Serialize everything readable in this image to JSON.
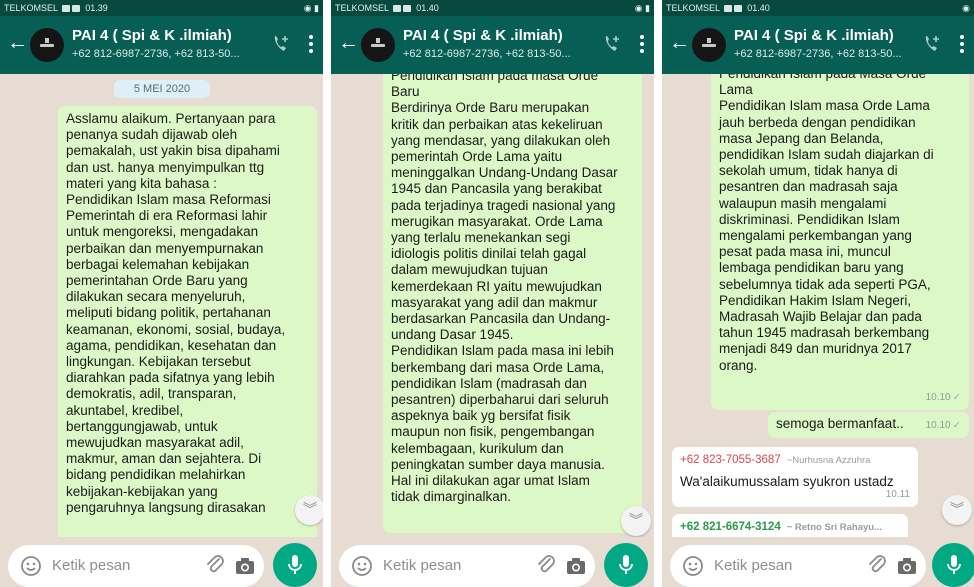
{
  "status": {
    "carrier": "TELKOMSEL",
    "times": [
      "01.39",
      "01.40",
      "01.40"
    ]
  },
  "chat": {
    "title": "PAI 4 ( Spi & K .ilmiah)",
    "members_preview": "+62 812-6987-2736, +62 813-50..."
  },
  "input": {
    "placeholder": "Ketik pesan"
  },
  "icons": {
    "back": "arrow-left-icon",
    "call": "add-call-icon",
    "menu": "more-vert-icon",
    "emoji": "emoji-icon",
    "attach": "paperclip-icon",
    "camera": "camera-icon",
    "mic": "mic-icon",
    "scroll": "chevron-double-down-icon"
  },
  "colors": {
    "header": "#075e54",
    "bubble_out": "#dcf8c6",
    "accent": "#00a884"
  },
  "panel1": {
    "date_chip": "5 MEI 2020",
    "message": "Asslamu alaikum. Pertanyaan para\npenanya  sudah dijawab oleh\npemakalah, ust yakin bisa dipahami\ndan ust. hanya menyimpulkan ttg\nmateri yang kita bahasa :\n Pendidikan Islam masa Reformasi\nPemerintah di era Reformasi lahir\nuntuk mengoreksi, mengadakan\nperbaikan dan menyempurnakan\nberbagai kelemahan kebijakan\npemerintahan Orde Baru yang\ndilakukan secara menyeluruh,\nmeliputi bidang politik, pertahanan\nkeamanan, ekonomi, sosial, budaya,\nagama, pendidikan, kesehatan dan\nlingkungan. Kebijakan tersebut\ndiarahkan pada sifatnya yang lebih\ndemokratis, adil, transparan,\nakuntabel, kredibel,\nbertanggungjawab, untuk\nmewujudkan masyarakat adil,\nmakmur, aman dan sejahtera. Di\nbidang pendidikan melahirkan\nkebijakan-kebijakan yang\npengaruhnya langsung dirasakan"
  },
  "panel2": {
    "message": "Pendidikan Islam pada masa Orde\nBaru\n Berdirinya Orde Baru merupakan\nkritik dan perbaikan atas kekeliruan\nyang mendasar, yang dilakukan oleh\npemerintah Orde Lama yaitu\nmeninggalkan Undang-Undang Dasar\n1945 dan Pancasila yang berakibat\npada terjadinya tragedi nasional yang\nmerugikan masyarakat. Orde Lama\nyang terlalu menekankan segi\nidiologis politis dinilai telah gagal\ndalam mewujudkan tujuan\nkemerdekaan RI yaitu mewujudkan\nmasyarakat yang adil dan makmur\nberdasarkan Pancasila dan Undang-\nundang Dasar 1945.\nPendidikan Islam pada masa ini lebih\nberkembang dari masa Orde Lama,\npendidikan Islam (madrasah dan\npesantren) diperbaharui dari seluruh\naspeknya baik yg bersifat fisik\nmaupun non fisik, pengembangan\nkelembagaan, kurikulum dan\npeningkatan sumber daya manusia.\nHal ini dilakukan agar umat Islam\ntidak dimarginalkan."
  },
  "panel3": {
    "message": "Pendidikan Islam pada Masa Orde\nLama\nPendidikan Islam masa Orde Lama\njauh berbeda dengan pendidikan\nmasa Jepang dan Belanda,\npendidikan Islam sudah diajarkan di\nsekolah umum, tidak hanya di\npesantren dan madrasah saja\nwalaupun masih mengalami\ndiskriminasi. Pendidikan Islam\nmengalami perkembangan yang\npesat pada masa ini, muncul\nlembaga pendidikan baru yang\nsebelumnya tidak ada seperti PGA,\nPendidikan Hakim Islam Negeri,\nMadrasah Wajib Belajar dan pada\ntahun 1945 madrasah berkembang\nmenjadi 849 dan muridnya 2017\norang.",
    "message_time": "10.10",
    "followup": "semoga bermanfaat..",
    "followup_time": "10.10",
    "reply1": {
      "sender": "+62 823-7055-3687",
      "alias": "~Nurhusna Azzuhra",
      "text": "Wa'alaikumussalam syukron ustadz",
      "time": "10.11"
    },
    "reply2": {
      "sender": "+62 821-6674-3124",
      "alias": "~ Retno Sri Rahayu..."
    }
  }
}
